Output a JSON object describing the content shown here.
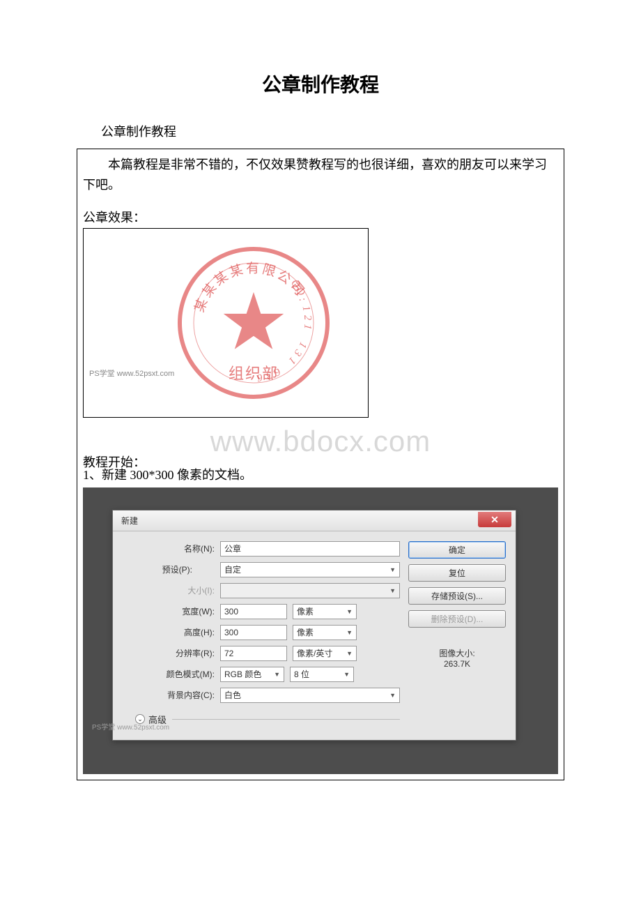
{
  "title": "公章制作教程",
  "subtitle": "公章制作教程",
  "intro": "本篇教程是非常不错的，不仅效果赞教程写的也很详细，喜欢的朋友可以来学习下吧。",
  "effect_label": "公章效果：",
  "stamp": {
    "company_text": "某某某某有限公司",
    "qq_text": "QQ:121 131 636",
    "bottom_text": "组织部",
    "watermark": "PS学堂  www.52psxt.com"
  },
  "center_watermark": "www.bdocx.com",
  "step_label": "教程开始：",
  "step1": "1、新建 300*300 像素的文档。",
  "dialog": {
    "title": "新建",
    "fields": {
      "name_label": "名称(N):",
      "name_value": "公章",
      "preset_label": "预设(P):",
      "preset_value": "自定",
      "size_label": "大小(I):",
      "width_label": "宽度(W):",
      "width_value": "300",
      "width_unit": "像素",
      "height_label": "高度(H):",
      "height_value": "300",
      "height_unit": "像素",
      "res_label": "分辨率(R):",
      "res_value": "72",
      "res_unit": "像素/英寸",
      "mode_label": "颜色模式(M):",
      "mode_value": "RGB 颜色",
      "mode_bits": "8 位",
      "bg_label": "背景内容(C):",
      "bg_value": "白色",
      "advanced": "高级"
    },
    "buttons": {
      "ok": "确定",
      "reset": "复位",
      "save_preset": "存储预设(S)...",
      "del_preset": "删除预设(D)..."
    },
    "image_size_label": "图像大小:",
    "image_size_value": "263.7K",
    "watermark": "PS学堂  www.52psxt.com"
  }
}
